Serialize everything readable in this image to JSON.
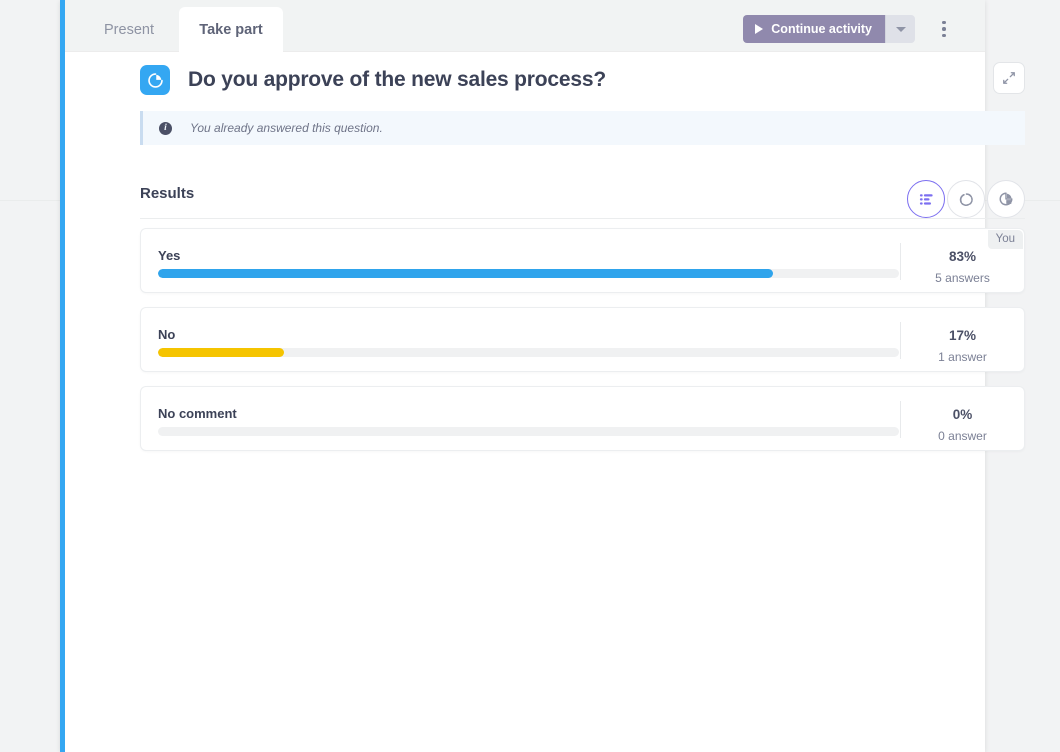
{
  "tabs": [
    {
      "label": "Present",
      "active": false
    },
    {
      "label": "Take part",
      "active": true
    }
  ],
  "toolbar": {
    "continue_label": "Continue activity",
    "continue_color": "#9089ad",
    "play_icon": "play-icon",
    "caret_icon": "chevron-down-icon",
    "kebab_icon": "more-vertical-icon"
  },
  "question": {
    "icon": "pie-chart-icon",
    "icon_color": "#34a7f2",
    "title": "Do you approve of the new sales process?",
    "collapse_icon": "collapse-diagonal-icon"
  },
  "info_banner": {
    "icon": "info-icon",
    "glyph": "i",
    "text": "You already answered this question.",
    "background": "#f3f8fd",
    "accent": "#c9dcf0"
  },
  "results": {
    "title": "Results",
    "view_toggles": [
      {
        "name": "bar-chart-view-icon",
        "active": true
      },
      {
        "name": "donut-chart-view-icon",
        "active": false
      },
      {
        "name": "pie-chart-3d-view-icon",
        "active": false
      }
    ],
    "active_toggle_color": "#7c6ff0"
  },
  "chart_data": {
    "type": "bar",
    "title": "Results",
    "orientation": "horizontal",
    "categories": [
      "Yes",
      "No",
      "No comment"
    ],
    "values": [
      83,
      17,
      0
    ],
    "counts": [
      5,
      1,
      0
    ],
    "count_labels": [
      "5 answers",
      "1 answer",
      "0 answer"
    ],
    "percent_labels": [
      "83%",
      "17%",
      "0%"
    ],
    "colors": [
      "#2fa4ec",
      "#f5c400",
      "#eceef0"
    ],
    "track_color": "#f0f1f2",
    "xlabel": "",
    "ylabel": "",
    "xlim": [
      0,
      100
    ],
    "grid": false,
    "legend": false,
    "user_answer": "Yes",
    "user_badge": "You"
  }
}
